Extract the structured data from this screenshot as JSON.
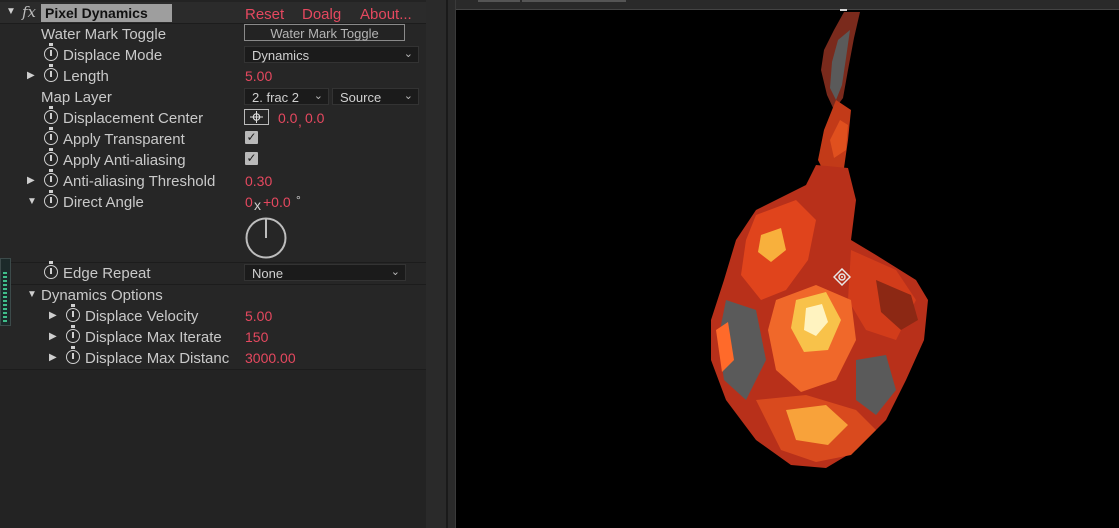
{
  "effect": {
    "fx_label": "fx",
    "name": "Pixel Dynamics",
    "reset": "Reset",
    "dialog": "Doalg",
    "about": "About..."
  },
  "params": {
    "watermark": {
      "label": "Water Mark Toggle",
      "button": "Water Mark Toggle"
    },
    "displace_mode": {
      "label": "Displace Mode",
      "value": "Dynamics"
    },
    "length": {
      "label": "Length",
      "value": "5.00"
    },
    "map_layer": {
      "label": "Map Layer",
      "layer": "2. frac 2",
      "source": "Source"
    },
    "displacement_center": {
      "label": "Displacement Center",
      "x": "0.0",
      "sep": ",",
      "y": "0.0"
    },
    "apply_transparent": {
      "label": "Apply Transparent",
      "checked": true
    },
    "apply_antialiasing": {
      "label": "Apply Anti-aliasing",
      "checked": true
    },
    "aa_threshold": {
      "label": "Anti-aliasing Threshold",
      "value": "0.30"
    },
    "direct_angle": {
      "label": "Direct Angle",
      "rev": "0",
      "x": "x",
      "deg": "+0.0",
      "unit": "°"
    },
    "edge_repeat": {
      "label": "Edge Repeat",
      "value": "None"
    },
    "dynamics_options": {
      "label": "Dynamics Options"
    },
    "velocity": {
      "label": "Displace Velocity",
      "value": "5.00"
    },
    "max_iterate": {
      "label": "Displace Max Iterate",
      "value": "150"
    },
    "max_distance": {
      "label": "Displace Max Distanc",
      "value": "3000.00"
    }
  },
  "colors": {
    "panel_bg": "#232323",
    "value_red": "#e5485f",
    "viewer_bg": "#000000",
    "flame_dark": "#7a1a0c",
    "flame_mid": "#e0441c",
    "flame_hot": "#f8c24a",
    "flame_grey": "#5a5a5a"
  },
  "icons": [
    "twirl-triangle-icon",
    "stopwatch-icon",
    "crosshair-icon",
    "checkbox-icon",
    "angle-dial-icon",
    "chevron-down-icon",
    "anchor-point-icon"
  ]
}
